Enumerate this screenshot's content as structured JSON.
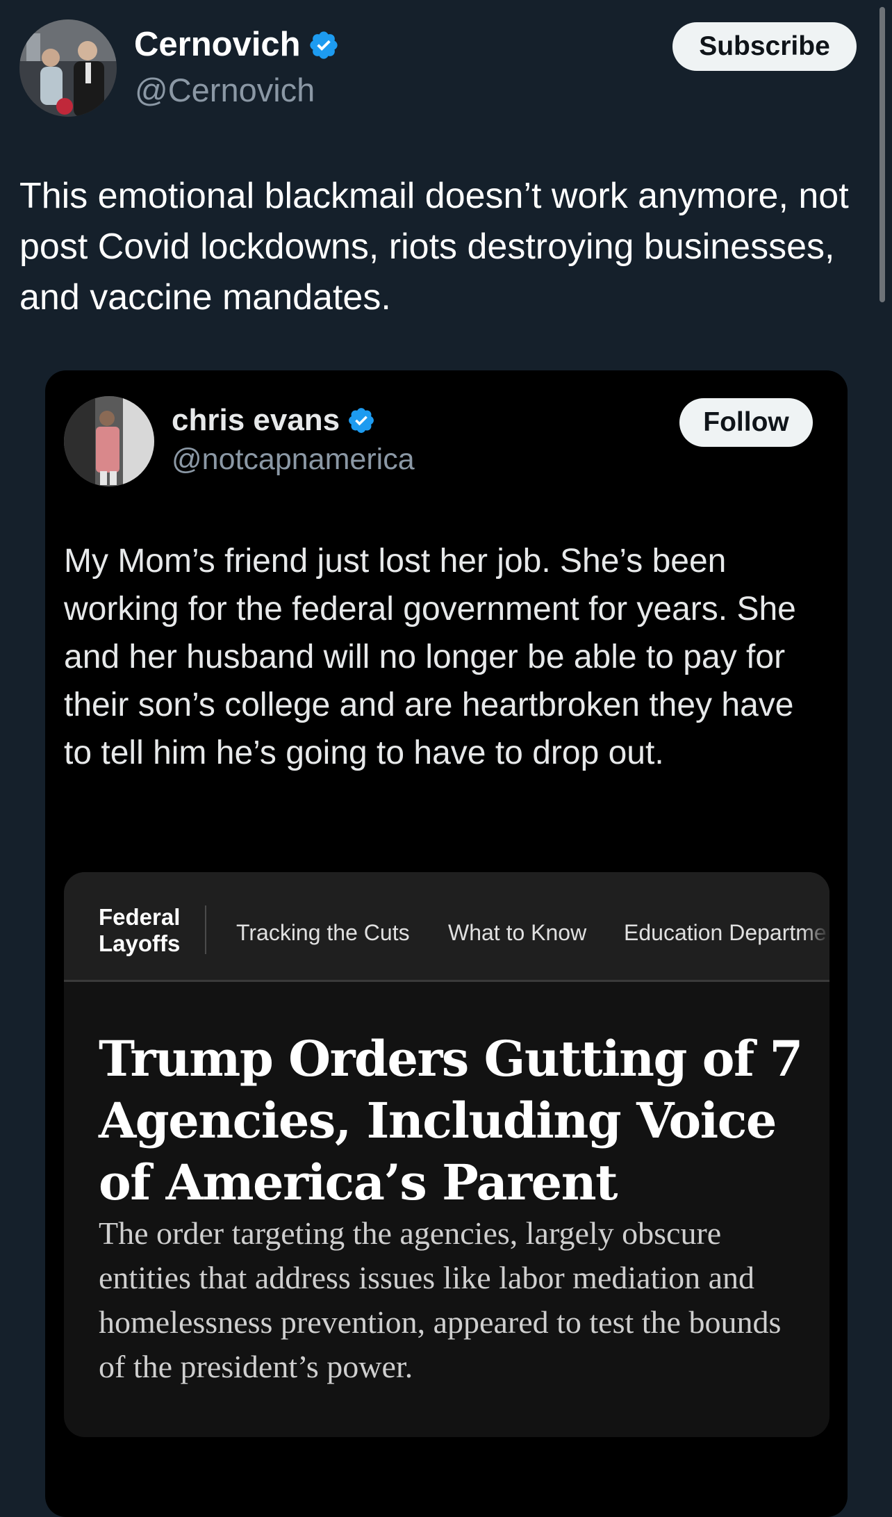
{
  "post": {
    "author": {
      "display_name": "Cernovich",
      "handle": "@Cernovich",
      "verified": true
    },
    "subscribe_label": "Subscribe",
    "text": "This emotional blackmail doesn’t work anymore, not post Covid lockdowns, riots destroying businesses, and vaccine mandates."
  },
  "quoted_post": {
    "author": {
      "display_name": "chris evans",
      "handle": "@notcapnamerica",
      "verified": true
    },
    "follow_label": "Follow",
    "text": "My Mom’s friend just lost her job. She’s been working for the federal government for years. She and her husband will no longer be able to pay for their son’s college and are heartbroken they have to tell him he’s going to have to drop out.",
    "article": {
      "section_line1": "Federal",
      "section_line2": "Layoffs",
      "nav_links": [
        "Tracking the Cuts",
        "What to Know",
        "Education Departme"
      ],
      "headline": "Trump Orders Gutting of 7 Agencies, Including Voice of America’s Parent",
      "summary": "The order targeting the agencies, largely obscure entities that address issues like labor mediation and homelessness prevention, appeared to test the bounds of the president’s power."
    }
  },
  "colors": {
    "background": "#15202b",
    "verified_badge": "#1d9bf0",
    "quote_background": "#000000",
    "button_background": "#eff3f4",
    "secondary_text": "#8b98a5"
  },
  "icons": {
    "verified": "verified-badge-icon"
  }
}
